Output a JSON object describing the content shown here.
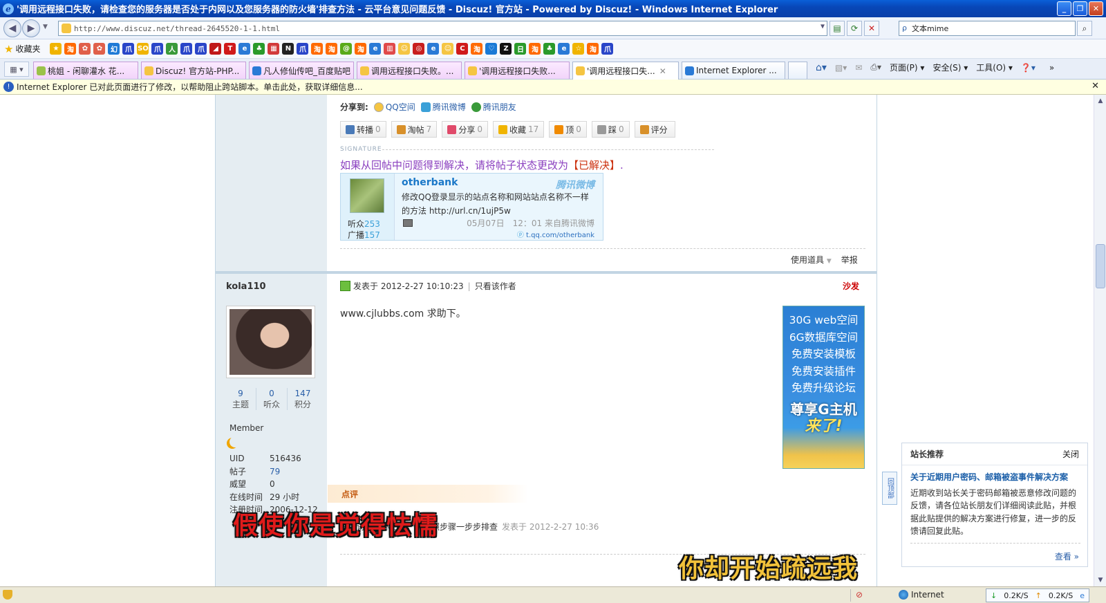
{
  "window": {
    "title": "'调用远程接口失败，请检查您的服务器是否处于内网以及您服务器的防火墙'排查方法 - 云平台意见问题反馈 - Discuz! 官方站 - Powered by Discuz! - Windows Internet Explorer"
  },
  "address": {
    "url": "http://www.discuz.net/thread-2645520-1-1.html",
    "search_value": "文本mime"
  },
  "favorites": {
    "label": "收藏夹",
    "icons": [
      {
        "name": "star-add-icon",
        "color": "#f0b400",
        "glyph": "★"
      },
      {
        "name": "taobao-icon",
        "color": "#ff6a00",
        "glyph": "淘"
      },
      {
        "name": "flower-icon",
        "color": "#e0604a",
        "glyph": "✿"
      },
      {
        "name": "flower-icon",
        "color": "#e0604a",
        "glyph": "✿"
      },
      {
        "name": "app-icon",
        "color": "#1f7ad6",
        "glyph": "幻"
      },
      {
        "name": "baidu-paw-icon",
        "color": "#2945c8",
        "glyph": "爪"
      },
      {
        "name": "sohu-icon",
        "color": "#f0b400",
        "glyph": "SO"
      },
      {
        "name": "baidu-paw-icon",
        "color": "#2945c8",
        "glyph": "爪"
      },
      {
        "name": "user-icon",
        "color": "#3a9a3a",
        "glyph": "人"
      },
      {
        "name": "baidu-paw-icon",
        "color": "#2945c8",
        "glyph": "爪"
      },
      {
        "name": "baidu-paw-icon",
        "color": "#2945c8",
        "glyph": "爪"
      },
      {
        "name": "flag-icon",
        "color": "#c01818",
        "glyph": "◢"
      },
      {
        "name": "t-icon",
        "color": "#d01a1a",
        "glyph": "T"
      },
      {
        "name": "ie-icon",
        "color": "#2a7ad6",
        "glyph": "e"
      },
      {
        "name": "tree-icon",
        "color": "#2a9a2a",
        "glyph": "♣"
      },
      {
        "name": "grid-icon",
        "color": "#d23a3a",
        "glyph": "▦"
      },
      {
        "name": "n-icon",
        "color": "#222222",
        "glyph": "N"
      },
      {
        "name": "baidu-paw-icon",
        "color": "#2945c8",
        "glyph": "爪"
      },
      {
        "name": "taobao-icon",
        "color": "#ff6a00",
        "glyph": "淘"
      },
      {
        "name": "taobao-icon",
        "color": "#ff6a00",
        "glyph": "淘"
      },
      {
        "name": "green-icon",
        "color": "#5aaa1a",
        "glyph": "@"
      },
      {
        "name": "taobao-icon",
        "color": "#ff6a00",
        "glyph": "淘"
      },
      {
        "name": "ie-icon",
        "color": "#2a7ad6",
        "glyph": "e"
      },
      {
        "name": "chart-icon",
        "color": "#e04a4a",
        "glyph": "▥"
      },
      {
        "name": "chat-icon",
        "color": "#f5c542",
        "glyph": "☺"
      },
      {
        "name": "toyota-icon",
        "color": "#c81e1e",
        "glyph": "◎"
      },
      {
        "name": "ie-icon",
        "color": "#2a7ad6",
        "glyph": "e"
      },
      {
        "name": "chat-icon",
        "color": "#f5c542",
        "glyph": "☺"
      },
      {
        "name": "c-icon",
        "color": "#d01a1a",
        "glyph": "C"
      },
      {
        "name": "taobao-icon",
        "color": "#ff6a00",
        "glyph": "淘"
      },
      {
        "name": "heart-icon",
        "color": "#1a7ad6",
        "glyph": "♡"
      },
      {
        "name": "z-icon",
        "color": "#111111",
        "glyph": "Z"
      },
      {
        "name": "calendar-icon",
        "color": "#2a9a2a",
        "glyph": "日"
      },
      {
        "name": "taobao-icon",
        "color": "#ff6a00",
        "glyph": "淘"
      },
      {
        "name": "clover-icon",
        "color": "#2a9a2a",
        "glyph": "♣"
      },
      {
        "name": "ie-icon",
        "color": "#2a7ad6",
        "glyph": "e"
      },
      {
        "name": "star-icon",
        "color": "#f0b400",
        "glyph": "☆"
      },
      {
        "name": "taobao-icon",
        "color": "#ff6a00",
        "glyph": "淘"
      },
      {
        "name": "baidu-paw-icon",
        "color": "#2945c8",
        "glyph": "爪"
      }
    ]
  },
  "tabs": [
    {
      "label": "桃姐 - 闲聊灌水 花..."
    },
    {
      "label": "Discuz! 官方站-PHP..."
    },
    {
      "label": "凡人修仙传吧_百度贴吧"
    },
    {
      "label": "调用远程接口失败。..."
    },
    {
      "label": "'调用远程接口失败..."
    },
    {
      "label": "'调用远程接口失..."
    },
    {
      "label": "Internet Explorer ..."
    }
  ],
  "commands": {
    "page": "页面(P)",
    "safety": "安全(S)",
    "tools": "工具(O)"
  },
  "infobar": {
    "text": "Internet Explorer 已对此页面进行了修改，以帮助阻止跨站脚本。单击此处，获取详细信息..."
  },
  "share": {
    "label": "分享到:",
    "qzone": "QQ空间",
    "tweibo": "腾讯微博",
    "pengyou": "腾讯朋友"
  },
  "actions": [
    {
      "label": "转播",
      "count": "0",
      "color": "#4a7ab8"
    },
    {
      "label": "淘帖",
      "count": "7",
      "color": "#d8902a"
    },
    {
      "label": "分享",
      "count": "0",
      "color": "#e04a6a"
    },
    {
      "label": "收藏",
      "count": "17",
      "color": "#f0b400"
    },
    {
      "label": "顶",
      "count": "0",
      "color": "#f08a00"
    },
    {
      "label": "踩",
      "count": "0",
      "color": "#999999"
    },
    {
      "label": "评分",
      "count": "",
      "color": "#d8902a"
    }
  ],
  "signature": {
    "label": "SIGNATURE",
    "text": "如果从回帖中问题得到解决，请将帖子状态更改为",
    "highlight": "【已解决】",
    "end": "."
  },
  "weibo": {
    "name": "otherbank",
    "brand": "腾讯微博",
    "text": "修改QQ登录显示的站点名称和网站站点名称不一样的方法 http://url.cn/1ujP5w",
    "listeners_label": "听众",
    "listeners": "253",
    "broadcasts_label": "广播",
    "broadcasts": "157",
    "time": "05月07日　12：01 来自腾讯微博",
    "url": "t.qq.com/otherbank"
  },
  "post_tools": {
    "use_item": "使用道具",
    "report": "举报"
  },
  "post": {
    "author": "kola110",
    "meta": "发表于 2012-2-27 10:10:23",
    "only_author": "只看该作者",
    "floor": "沙发",
    "message": "www.cjlubbs.com 求助下。"
  },
  "user": {
    "stats": [
      {
        "value": "9",
        "label": "主题"
      },
      {
        "value": "0",
        "label": "听众"
      },
      {
        "value": "147",
        "label": "积分"
      }
    ],
    "group": "Member",
    "info": [
      {
        "k": "UID",
        "v": "516436",
        "blue": false
      },
      {
        "k": "帖子",
        "v": "79",
        "blue": true
      },
      {
        "k": "威望",
        "v": "0",
        "blue": false
      },
      {
        "k": "在线时间",
        "v": "29 小时",
        "blue": false
      },
      {
        "k": "注册时间",
        "v": "2006-12-12",
        "blue": false
      }
    ]
  },
  "ad": {
    "lines": [
      "30G web空间",
      "6G数据库空间",
      "免费安装模板",
      "免费安装插件",
      "免费升级论坛"
    ],
    "big": "尊享G主机",
    "come": "来了!"
  },
  "comment": {
    "header": "点评",
    "text": "器能访问到你站点，请按照步骤一步步排查",
    "time": "发表于 2012-2-27 10:36"
  },
  "back_to_top": "回顶部",
  "recommend": {
    "title": "站长推荐",
    "close": "关闭",
    "headline": "关于近期用户密码、邮箱被盗事件解决方案",
    "body": "近期收到站长关于密码邮箱被恶意修改问题的反馈，请各位站长朋友们详细阅读此贴，并根据此贴提供的解决方案进行修复，进一步的反馈请回复此贴。",
    "more": "查看 »"
  },
  "subtitles": {
    "line1": "假使你是觉得怯懦",
    "line2": "你却开始疏远我"
  },
  "status": {
    "zone": "Internet",
    "down": "0.2K/S",
    "up": "0.2K/S"
  }
}
